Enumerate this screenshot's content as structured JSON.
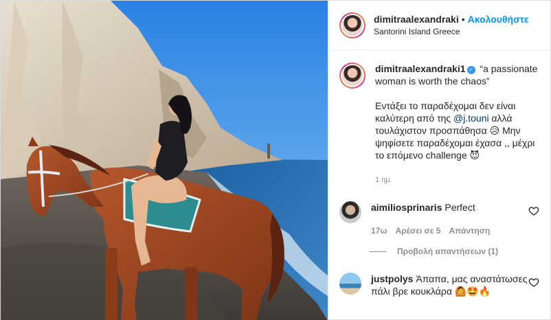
{
  "header": {
    "username": "dimitraalexandraki",
    "separator": "•",
    "follow_label": "Ακολουθήστε",
    "location": "Santorini Island Greece"
  },
  "caption": {
    "username": "dimitraalexandraki1",
    "verified": true,
    "quote": "“a passionate woman is worth the chaos”",
    "text_before_mention": "Εντάξει το παραδέχομαι δεν είναι καλύτερη από της",
    "mention": "@j.touni",
    "text_after_mention": "αλλά τουλάχιστον προσπάθησα",
    "emoji_1": "😥",
    "text_after_emoji": "Μην ψηφίσετε παραδέχομαι έχασα ,, μέχρι το επόμενο challenge",
    "emoji_2": "😈",
    "time": "1 ημ."
  },
  "comments": [
    {
      "username": "aimiliosprinaris",
      "text": "Perfect",
      "time": "17ω",
      "likes": "Αρέσει σε 5",
      "reply": "Απάντηση",
      "view_replies": "Προβολή απαντήσεων (1)"
    },
    {
      "username": "justpolys",
      "text": "Άπαπα, μας αναστάτωσες πάλι βρε κουκλάρα",
      "emojis": "🙆🤩🔥"
    }
  ],
  "colors": {
    "accent": "#0095f6",
    "verified": "#3897f0",
    "muted": "#8e8e8e",
    "mention": "#00376b"
  },
  "icons": [
    "verified-badge-icon",
    "heart-icon"
  ]
}
